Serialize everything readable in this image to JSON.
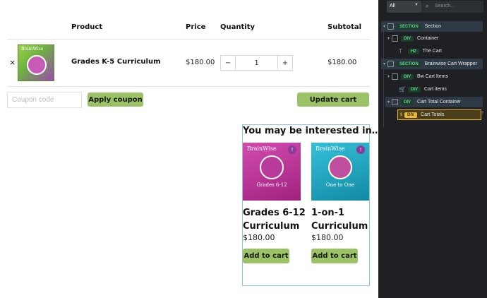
{
  "cart": {
    "headers": {
      "product": "Product",
      "price": "Price",
      "quantity": "Quantity",
      "subtotal": "Subtotal"
    },
    "item": {
      "remove": "×",
      "name": "Grades K-5 Curriculum",
      "price": "$180.00",
      "quantity": "1",
      "subtotal": "$180.00",
      "thumb_label": "BrainWise",
      "thumb_grade": "Grades K-5"
    },
    "qty_minus": "−",
    "qty_plus": "+",
    "coupon_placeholder": "Coupon code",
    "apply_label": "Apply coupon",
    "update_label": "Update cart"
  },
  "related": {
    "title": "You may be interested in…",
    "products": [
      {
        "name_line1": "Grades 6-12",
        "name_line2": "Curriculum",
        "price": "$180.00",
        "button": "Add to cart",
        "cover_title": "BrainWise",
        "cover_sub": "Grades 6-12",
        "color": "#c6359f"
      },
      {
        "name_line1": "1-on-1",
        "name_line2": "Curriculum",
        "price": "$180.00",
        "button": "Add to cart",
        "cover_title": "BrainWise",
        "cover_sub": "One to One",
        "color": "#1ea9c4"
      }
    ]
  },
  "navigator": {
    "filter": "All",
    "search_placeholder": "Search...",
    "items": [
      {
        "tag": "SECTION",
        "label": "Section"
      },
      {
        "tag": "DIV",
        "label": "Container"
      },
      {
        "tag": "H2",
        "label": "The Cart"
      },
      {
        "tag": "SECTION",
        "label": "Brainwise Cart Wrapper"
      },
      {
        "tag": "DIV",
        "label": "Bw Cart Items"
      },
      {
        "tag": "DIV",
        "label": "Cart items"
      },
      {
        "tag": "DIV",
        "label": "Cart Total Container"
      },
      {
        "tag": "DIV",
        "label": "Cart Totals"
      }
    ]
  },
  "colors": {
    "button_green": "#9cc266",
    "panel_bg": "#1e2023",
    "selected_outline": "#e8b93a",
    "highlight_border": "#8ec6e0"
  }
}
